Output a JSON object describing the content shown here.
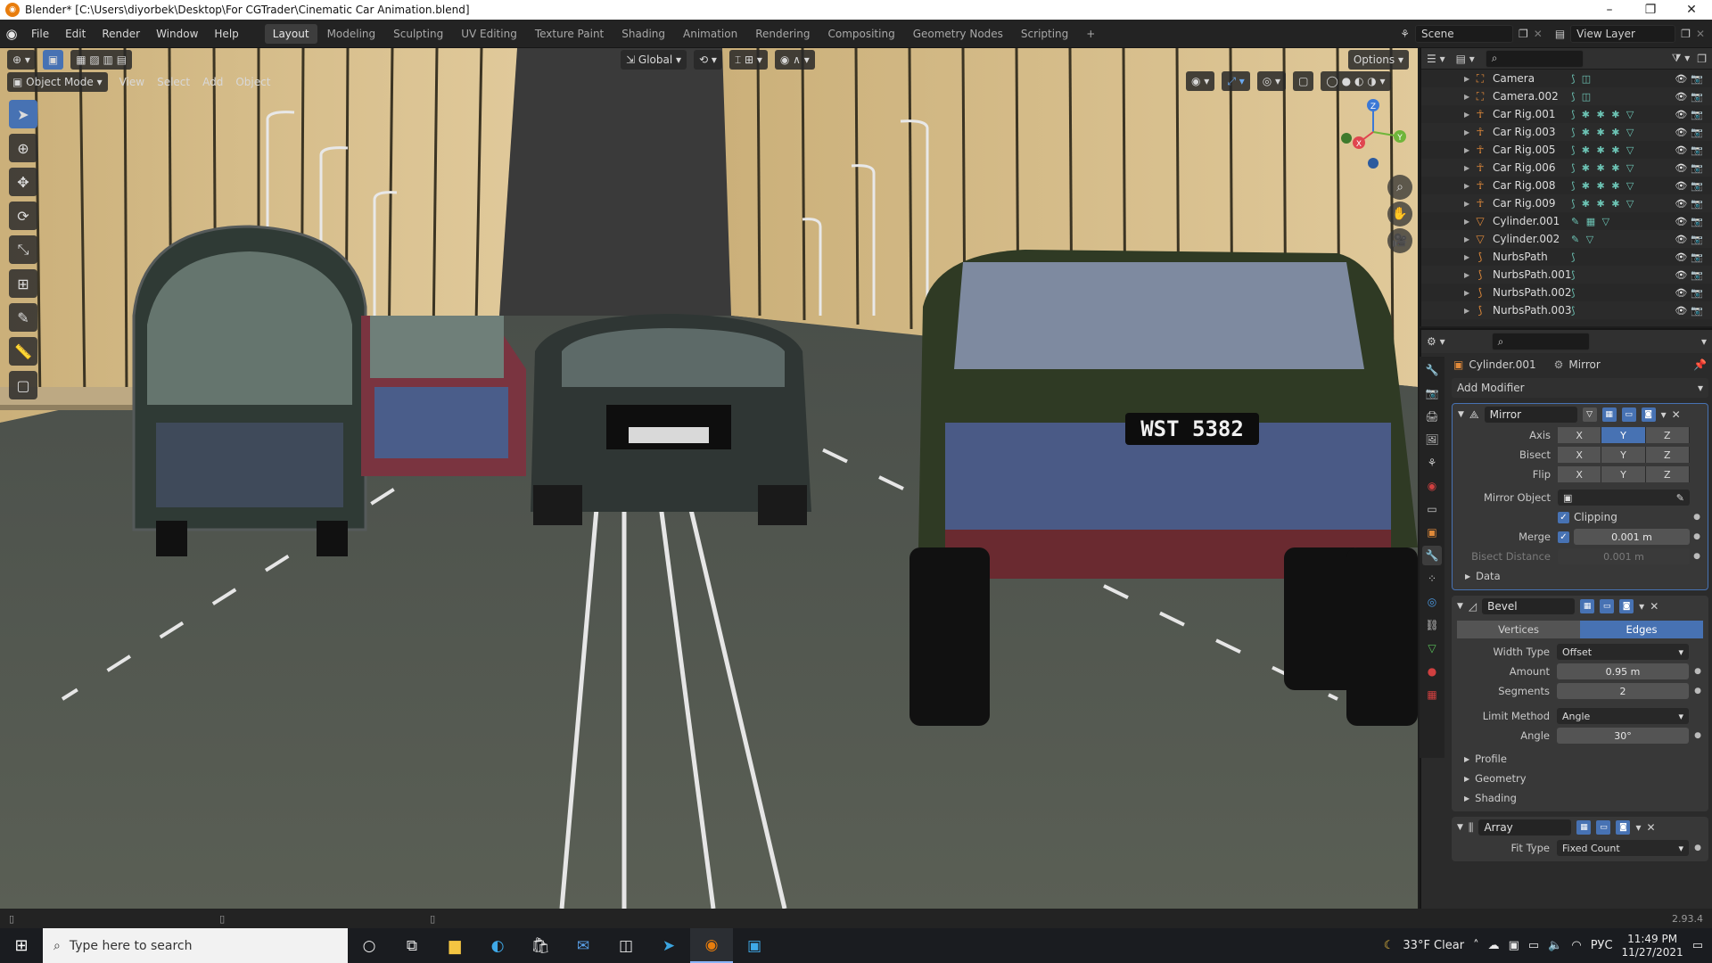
{
  "titlebar": {
    "title": "Blender* [C:\\Users\\diyorbek\\Desktop\\For CGTrader\\Cinematic Car Animation.blend]",
    "controls": [
      "–",
      "❐",
      "✕"
    ]
  },
  "menu": {
    "items": [
      "File",
      "Edit",
      "Render",
      "Window",
      "Help"
    ],
    "workspaces": [
      "Layout",
      "Modeling",
      "Sculpting",
      "UV Editing",
      "Texture Paint",
      "Shading",
      "Animation",
      "Rendering",
      "Compositing",
      "Geometry Nodes",
      "Scripting"
    ],
    "active_workspace": "Layout",
    "scene": "Scene",
    "view_layer": "View Layer"
  },
  "viewport": {
    "mode": "Object Mode",
    "menus": [
      "View",
      "Select",
      "Add",
      "Object"
    ],
    "orientation": "Global",
    "options": "Options",
    "plate": "WST 5382",
    "gizmo": {
      "x": "X",
      "y": "Y",
      "z": "Z"
    }
  },
  "outliner": {
    "items": [
      {
        "name": "Camera",
        "icon": "camera-icon",
        "mods": "⟆ ◫"
      },
      {
        "name": "Camera.002",
        "icon": "camera-icon",
        "mods": "⟆ ◫"
      },
      {
        "name": "Car Rig.001",
        "icon": "armature-icon",
        "mods": "⟆ ✱ ✱ ✱ ▽"
      },
      {
        "name": "Car Rig.003",
        "icon": "armature-icon",
        "mods": "⟆ ✱ ✱ ✱ ▽"
      },
      {
        "name": "Car Rig.005",
        "icon": "armature-icon",
        "mods": "⟆ ✱ ✱ ✱ ▽"
      },
      {
        "name": "Car Rig.006",
        "icon": "armature-icon",
        "mods": "⟆ ✱ ✱ ✱ ▽"
      },
      {
        "name": "Car Rig.008",
        "icon": "armature-icon",
        "mods": "⟆ ✱ ✱ ✱ ▽"
      },
      {
        "name": "Car Rig.009",
        "icon": "armature-icon",
        "mods": "⟆ ✱ ✱ ✱ ▽"
      },
      {
        "name": "Cylinder.001",
        "icon": "mesh-icon",
        "mods": "✎ ▦ ▽"
      },
      {
        "name": "Cylinder.002",
        "icon": "mesh-icon",
        "mods": "✎ ▽"
      },
      {
        "name": "NurbsPath",
        "icon": "curve-icon",
        "mods": "⟆"
      },
      {
        "name": "NurbsPath.001",
        "icon": "curve-icon",
        "mods": "⟆"
      },
      {
        "name": "NurbsPath.002",
        "icon": "curve-icon",
        "mods": "⟆"
      },
      {
        "name": "NurbsPath.003",
        "icon": "curve-icon",
        "mods": "⟆"
      }
    ]
  },
  "properties": {
    "object": "Cylinder.001",
    "context": "Mirror",
    "add_modifier": "Add Modifier",
    "mirror": {
      "name": "Mirror",
      "axis_label": "Axis",
      "bisect_label": "Bisect",
      "flip_label": "Flip",
      "axes": [
        "X",
        "Y",
        "Z"
      ],
      "axis_active": "Y",
      "mirror_object_label": "Mirror Object",
      "clipping_label": "Clipping",
      "merge_label": "Merge",
      "merge_value": "0.001 m",
      "bisect_distance_label": "Bisect Distance",
      "bisect_distance_value": "0.001 m",
      "data_label": "Data"
    },
    "bevel": {
      "name": "Bevel",
      "vertices": "Vertices",
      "edges": "Edges",
      "width_type_label": "Width Type",
      "width_type": "Offset",
      "amount_label": "Amount",
      "amount": "0.95 m",
      "segments_label": "Segments",
      "segments": "2",
      "limit_method_label": "Limit Method",
      "limit_method": "Angle",
      "angle_label": "Angle",
      "angle": "30°",
      "subpanels": [
        "Profile",
        "Geometry",
        "Shading"
      ]
    },
    "array": {
      "name": "Array",
      "fit_type_label": "Fit Type",
      "fit_type": "Fixed Count"
    }
  },
  "status": {
    "version": "2.93.4"
  },
  "taskbar": {
    "search_placeholder": "Type here to search",
    "weather": "33°F  Clear",
    "language": "РУС",
    "time": "11:49 PM",
    "date": "11/27/2021"
  }
}
